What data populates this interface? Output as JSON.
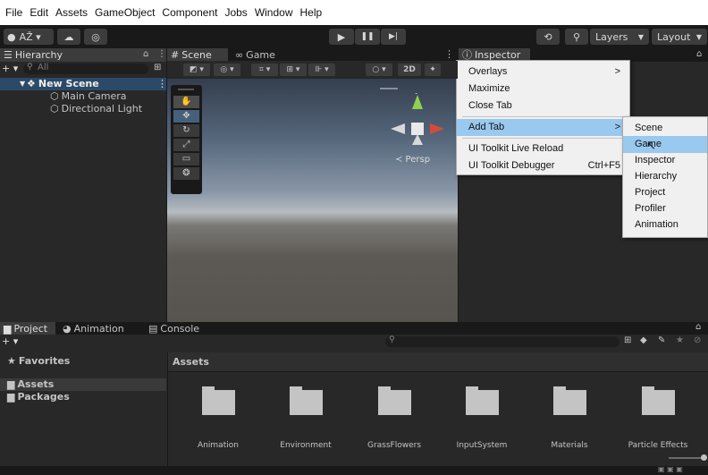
{
  "menubar": {
    "items": [
      "File",
      "Edit",
      "Assets",
      "GameObject",
      "Component",
      "Jobs",
      "Window",
      "Help"
    ]
  },
  "toolbar": {
    "account_label": "AŽ ▾",
    "play": "▶",
    "pause": "❚❚",
    "step": "▶|",
    "layers_label": "Layers",
    "layout_label": "Layout"
  },
  "hierarchy": {
    "tab_label": "Hierarchy",
    "add_label": "+ ▾",
    "search_placeholder": "All",
    "scene_name": "New Scene",
    "items": [
      "Main Camera",
      "Directional Light"
    ]
  },
  "scene": {
    "tab_scene": "Scene",
    "tab_game": "Game",
    "toggle_2d": "2D",
    "gizmo_x": "x",
    "gizmo_y": "y",
    "persp_label": "≺ Persp",
    "tools": [
      "✋",
      "✥",
      "↻",
      "⤢",
      "▭",
      "❂"
    ]
  },
  "inspector": {
    "tab_label": "Inspector"
  },
  "context_menu": {
    "items": [
      {
        "label": "Overlays",
        "arrow": ">"
      },
      {
        "label": "Maximize"
      },
      {
        "label": "Close Tab"
      },
      {
        "label": "Add Tab",
        "arrow": ">"
      },
      {
        "label": "UI Toolkit Live Reload"
      },
      {
        "label": "UI Toolkit Debugger",
        "shortcut": "Ctrl+F5"
      }
    ]
  },
  "submenu": {
    "items": [
      "Scene",
      "Game",
      "Inspector",
      "Hierarchy",
      "Project",
      "Profiler",
      "Animation"
    ]
  },
  "bottom": {
    "tabs": [
      "Project",
      "Animation",
      "Console"
    ],
    "add_label": "+ ▾",
    "favorites_label": "Favorites",
    "assets_label": "Assets",
    "packages_label": "Packages",
    "assets_header": "Assets",
    "folders": [
      "Animation",
      "Environment",
      "GrassFlowers",
      "InputSystem",
      "Materials",
      "Particle Effects"
    ]
  }
}
